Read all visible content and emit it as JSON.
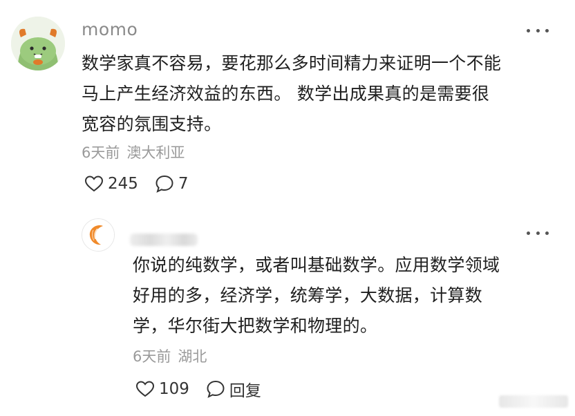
{
  "comment": {
    "username": "momo",
    "lines": [
      "数学家真不容易，要花那么多时间精力来证明一个不能",
      "马上产生经济效益的东西。 数学出成果真的是需要很",
      "宽容的氛围支持。"
    ],
    "time": "6天前",
    "location": "澳大利亚",
    "likes": "245",
    "comments": "7"
  },
  "reply": {
    "lines": [
      "你说的纯数学，或者叫基础数学。应用数学领域",
      "好用的多，经济学，统筹学，大数据，计算数",
      "学，华尔街大把数学和物理的。"
    ],
    "time": "6天前",
    "location": "湖北",
    "likes": "109",
    "reply_label": "回复"
  },
  "colors": {
    "text_primary": "#1f1f1f",
    "text_secondary": "#9a9a9a",
    "avatar_main_bg": "#eef3e8",
    "dragon_green": "#8fbf72",
    "croissant_orange": "#f08a2a"
  },
  "icons": {
    "like": "heart-outline-icon",
    "comment": "speech-bubble-icon",
    "more": "more-dots-icon"
  }
}
